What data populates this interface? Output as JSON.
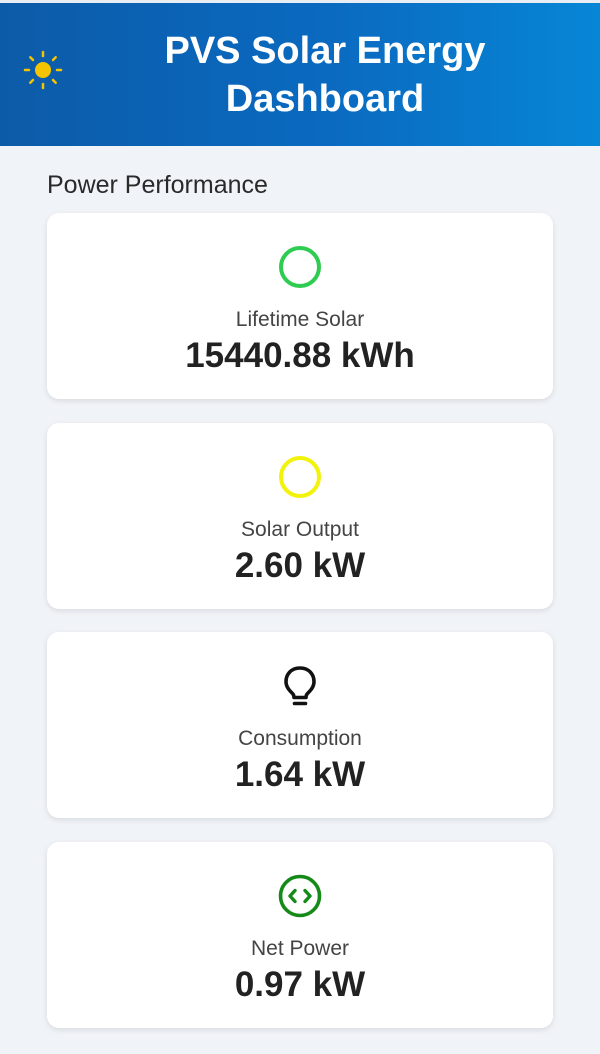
{
  "header": {
    "icon": "sun-icon",
    "title": "PVS Solar Energy Dashboard"
  },
  "section": {
    "title": "Power Performance"
  },
  "cards": [
    {
      "icon": "circle-icon",
      "icon_color": "#2ecc50",
      "label": "Lifetime Solar",
      "value": "15440.88 kWh"
    },
    {
      "icon": "circle-icon",
      "icon_color": "#f2f20a",
      "label": "Solar Output",
      "value": "2.60 kW"
    },
    {
      "icon": "lightbulb-icon",
      "icon_color": "#111111",
      "label": "Consumption",
      "value": "1.64 kW"
    },
    {
      "icon": "arrows-circle-icon",
      "icon_color": "#158a18",
      "label": "Net Power",
      "value": "0.97 kW"
    }
  ],
  "colors": {
    "header_gradient_start": "#0c5ba8",
    "header_gradient_end": "#0786d6",
    "sun": "#f5c400",
    "background": "#f0f3f7",
    "card": "#ffffff"
  }
}
